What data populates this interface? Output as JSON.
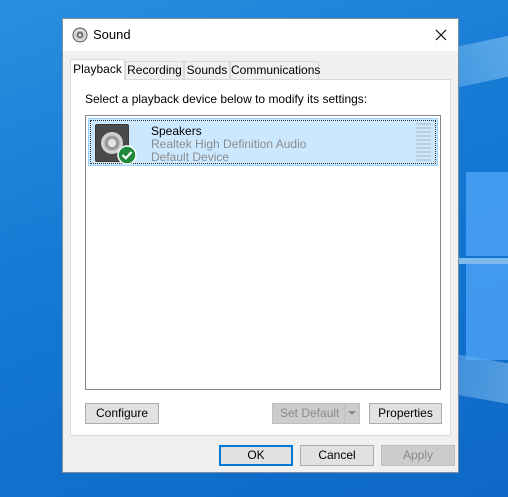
{
  "window": {
    "title": "Sound"
  },
  "tabs": [
    {
      "label": "Playback",
      "active": true
    },
    {
      "label": "Recording",
      "active": false
    },
    {
      "label": "Sounds",
      "active": false
    },
    {
      "label": "Communications",
      "active": false
    }
  ],
  "playback": {
    "instruction": "Select a playback device below to modify its settings:",
    "devices": [
      {
        "name": "Speakers",
        "driver": "Realtek High Definition Audio",
        "status": "Default Device",
        "selected": true,
        "icon": "speaker-icon",
        "badge": "check-badge-icon"
      }
    ],
    "buttons": {
      "configure": "Configure",
      "set_default": "Set Default",
      "properties": "Properties"
    }
  },
  "dialog_buttons": {
    "ok": "OK",
    "cancel": "Cancel",
    "apply": "Apply"
  },
  "colors": {
    "selection": "#cce8ff",
    "accent": "#0078d7",
    "check_badge": "#1e8a3a"
  }
}
